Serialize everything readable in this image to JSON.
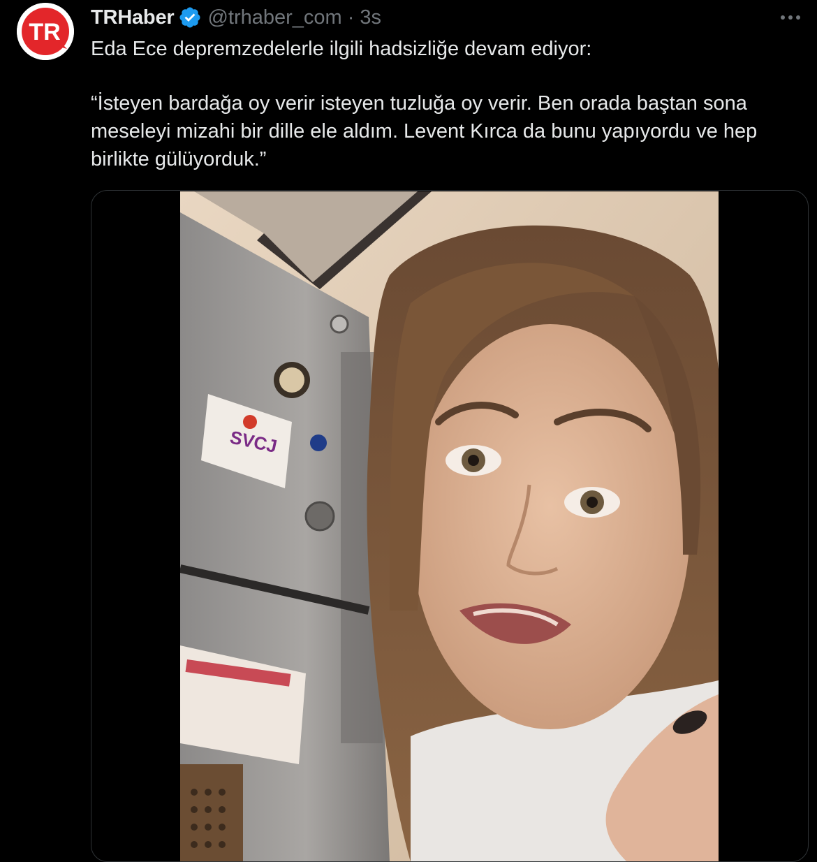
{
  "tweet": {
    "avatar_text": "TR",
    "display_name": "TRHaber",
    "handle": "@trhaber_com",
    "separator": "·",
    "time": "3s",
    "text_line1": "Eda Ece depremzedelerle ilgili hadsizliğe devam ediyor:",
    "text_quote": "“İsteyen bardağa oy verir isteyen tuzluğa oy verir. Ben orada baştan sona meseleyi mizahi bir dille ele aldım. Levent Kırca da bunu yapıyordu ve hep birlikte gülüyorduk.”"
  },
  "media": {
    "fridge_magnet_text": "SVCJ"
  },
  "icons": {
    "avatar": "trhaber-logo-icon",
    "verified": "verified-badge-icon",
    "more": "more-horizontal-icon",
    "video": "video-thumbnail"
  },
  "colors": {
    "background": "#000000",
    "text_primary": "#e7e9ea",
    "text_secondary": "#71767b",
    "verified_blue": "#1d9bf0",
    "brand_red": "#e3262a",
    "border": "#2f3336"
  }
}
